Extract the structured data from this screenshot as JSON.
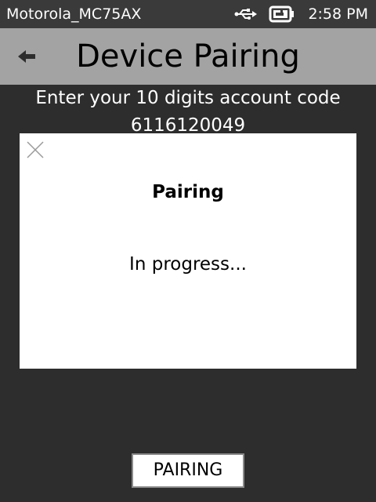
{
  "status_bar": {
    "device_name": "Motorola_MC75AX",
    "time": "2:58 PM",
    "icons": [
      "usb-icon",
      "battery-charging-icon"
    ]
  },
  "header": {
    "title": "Device Pairing",
    "back_icon": "back-arrow-icon"
  },
  "main": {
    "instruction": "Enter your 10 digits account code",
    "account_code": "6116120049"
  },
  "dialog": {
    "close_icon": "close-icon",
    "title": "Pairing",
    "message": "In progress..."
  },
  "footer": {
    "pairing_button_label": "PAIRING"
  },
  "colors": {
    "background": "#2d2d2d",
    "status_bar": "#3a3a3a",
    "title_bar": "#a3a3a3",
    "dialog": "#ffffff",
    "text_light": "#ffffff",
    "text_dark": "#000000"
  }
}
